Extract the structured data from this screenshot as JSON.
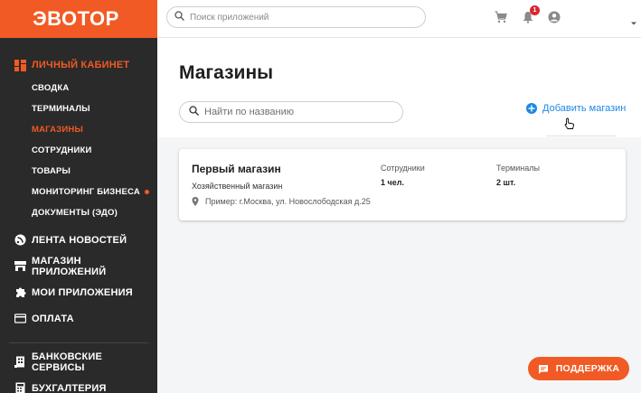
{
  "brand": {
    "logo": "ЭВОТОР",
    "accent": "#f15a24",
    "sidebar_bg": "#2a2a2a",
    "link_color": "#1e88e5"
  },
  "topbar": {
    "search_placeholder": "Поиск приложений",
    "notification_count": "1",
    "icons": [
      "search-icon",
      "cart-icon",
      "bell-icon",
      "user-icon",
      "caret-down-icon"
    ]
  },
  "sidebar": {
    "section": {
      "label": "ЛИЧНЫЙ КАБИНЕТ",
      "icon": "dashboard-icon"
    },
    "sub_items": [
      {
        "label": "СВОДКА",
        "active": false
      },
      {
        "label": "ТЕРМИНАЛЫ",
        "active": false
      },
      {
        "label": "МАГАЗИНЫ",
        "active": true
      },
      {
        "label": "СОТРУДНИКИ",
        "active": false
      },
      {
        "label": "ТОВАРЫ",
        "active": false
      },
      {
        "label": "МОНИТОРИНГ БИЗНЕСА",
        "active": false,
        "dot": true
      },
      {
        "label": "ДОКУМЕНТЫ (ЭДО)",
        "active": false
      }
    ],
    "main_items": [
      {
        "label": "ЛЕНТА НОВОСТЕЙ",
        "icon": "news-icon"
      },
      {
        "label": "МАГАЗИН ПРИЛОЖЕНИЙ",
        "icon": "store-icon"
      },
      {
        "label": "МОИ ПРИЛОЖЕНИЯ",
        "icon": "puzzle-icon"
      },
      {
        "label": "ОПЛАТА",
        "icon": "card-icon"
      }
    ],
    "bottom_items": [
      {
        "label": "БАНКОВСКИЕ СЕРВИСЫ",
        "icon": "bank-icon"
      },
      {
        "label": "БУХГАЛТЕРИЯ",
        "icon": "calculator-icon"
      }
    ]
  },
  "page": {
    "title": "Магазины",
    "search_placeholder": "Найти по названию",
    "add_label": "Добавить магазин"
  },
  "store": {
    "name": "Первый магазин",
    "type": "Хозяйственный магазин",
    "address": "Пример: г.Москва, ул. Новослободская д.25",
    "employees_label": "Сотрудники",
    "employees_value": "1 чел.",
    "terminals_label": "Терминалы",
    "terminals_value": "2 шт."
  },
  "support": {
    "label": "ПОДДЕРЖКА"
  }
}
